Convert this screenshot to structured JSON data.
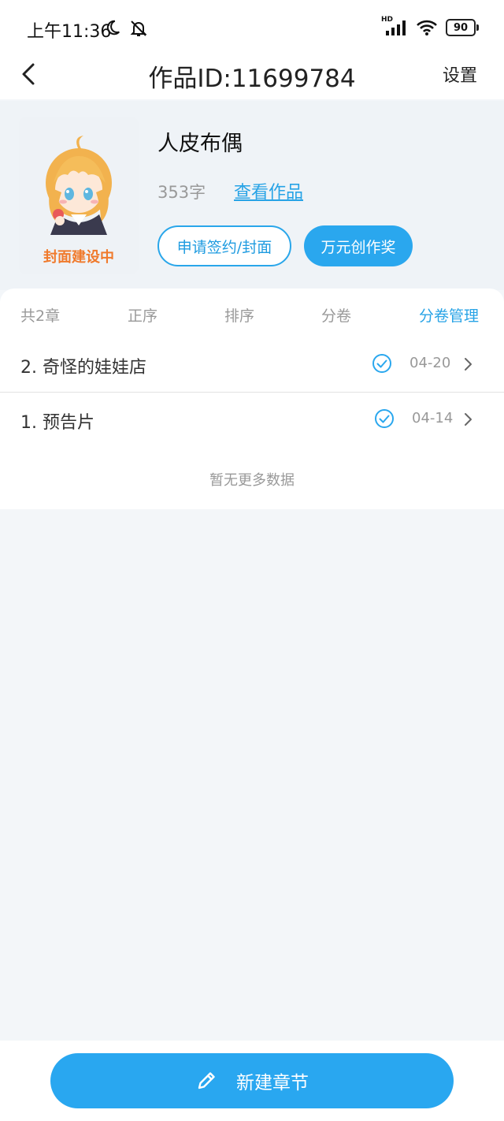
{
  "status_bar": {
    "time": "上午11:36",
    "network_badge": "HD",
    "battery": "90"
  },
  "header": {
    "title": "作品ID:11699784",
    "settings": "设置"
  },
  "work": {
    "cover_text": "封面建设中",
    "name": "人皮布偶",
    "word_count": "353字",
    "view_link": "查看作品",
    "apply_button": "申请签约/封面",
    "award_button": "万元创作奖"
  },
  "tabs": {
    "total": "共2章",
    "order": "正序",
    "sort": "排序",
    "volume": "分卷",
    "volume_manage": "分卷管理"
  },
  "chapters": [
    {
      "title": "2. 奇怪的娃娃店",
      "date": "04-20"
    },
    {
      "title": "1. 预告片",
      "date": "04-14"
    }
  ],
  "no_more": "暂无更多数据",
  "bottom": {
    "new_chapter": "新建章节"
  },
  "colors": {
    "accent": "#2aa7ee",
    "cover_text": "#f07a2c",
    "background": "#f3f6f9"
  }
}
